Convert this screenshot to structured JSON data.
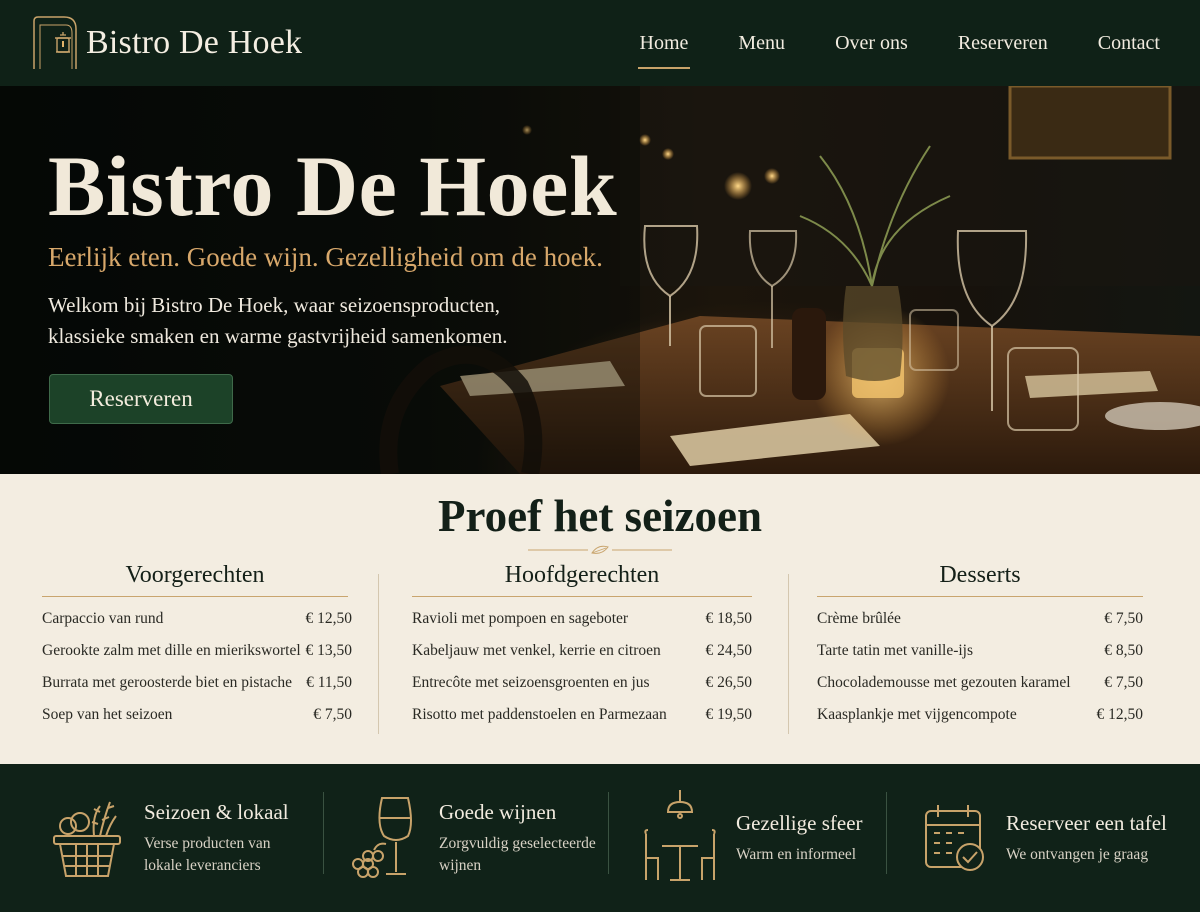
{
  "brand": {
    "name": "Bistro De Hoek"
  },
  "nav": {
    "items": [
      {
        "label": "Home",
        "active": true
      },
      {
        "label": "Menu"
      },
      {
        "label": "Over ons"
      },
      {
        "label": "Reserveren"
      },
      {
        "label": "Contact"
      }
    ]
  },
  "hero": {
    "title": "Bistro De Hoek",
    "tagline": "Eerlijk eten. Goede wijn. Gezelligheid om de hoek.",
    "text_line1": "Welkom bij Bistro De Hoek, waar seizoensproducten,",
    "text_line2": "klassieke smaken en warme gastvrijheid samenkomen.",
    "cta_label": "Reserveren"
  },
  "menu": {
    "title": "Proef het seizoen",
    "columns": [
      {
        "heading": "Voorgerechten",
        "items": [
          {
            "name": "Carpaccio van rund",
            "price": "€ 12,50"
          },
          {
            "name": "Gerookte zalm met dille en mierikswortel",
            "price": "€ 13,50"
          },
          {
            "name": "Burrata met geroosterde biet en pistache",
            "price": "€ 11,50"
          },
          {
            "name": "Soep van het seizoen",
            "price": "€ 7,50"
          }
        ]
      },
      {
        "heading": "Hoofdgerechten",
        "items": [
          {
            "name": "Ravioli met pompoen en sageboter",
            "price": "€ 18,50"
          },
          {
            "name": "Kabeljauw met venkel, kerrie en citroen",
            "price": "€ 24,50"
          },
          {
            "name": "Entrecôte met seizoensgroenten en jus",
            "price": "€ 26,50"
          },
          {
            "name": "Risotto met paddenstoelen en Parmezaan",
            "price": "€ 19,50"
          }
        ]
      },
      {
        "heading": "Desserts",
        "items": [
          {
            "name": "Crème brûlée",
            "price": "€ 7,50"
          },
          {
            "name": "Tarte tatin met vanille-ijs",
            "price": "€ 8,50"
          },
          {
            "name": "Chocolademousse met gezouten karamel",
            "price": "€ 7,50"
          },
          {
            "name": "Kaasplankje met vijgencompote",
            "price": "€ 12,50"
          }
        ]
      }
    ]
  },
  "features": [
    {
      "icon": "basket-icon",
      "title": "Seizoen & lokaal",
      "desc_line1": "Verse producten van",
      "desc_line2": "lokale leveranciers"
    },
    {
      "icon": "wine-glass-icon",
      "title": "Goede wijnen",
      "desc_line1": "Zorgvuldig geselecteerde",
      "desc_line2": "wijnen"
    },
    {
      "icon": "bistro-table-icon",
      "title": "Gezellige sfeer",
      "desc_line1": "Warm en informeel",
      "desc_line2": ""
    },
    {
      "icon": "calendar-check-icon",
      "title": "Reserveer een tafel",
      "desc_line1": "We ontvangen je graag",
      "desc_line2": ""
    }
  ],
  "colors": {
    "header_bg": "#0f2117",
    "accent_gold": "#c8a36a",
    "tagline": "#d8a86b",
    "cta_green": "#1c4228",
    "cream": "#f3ede1"
  }
}
